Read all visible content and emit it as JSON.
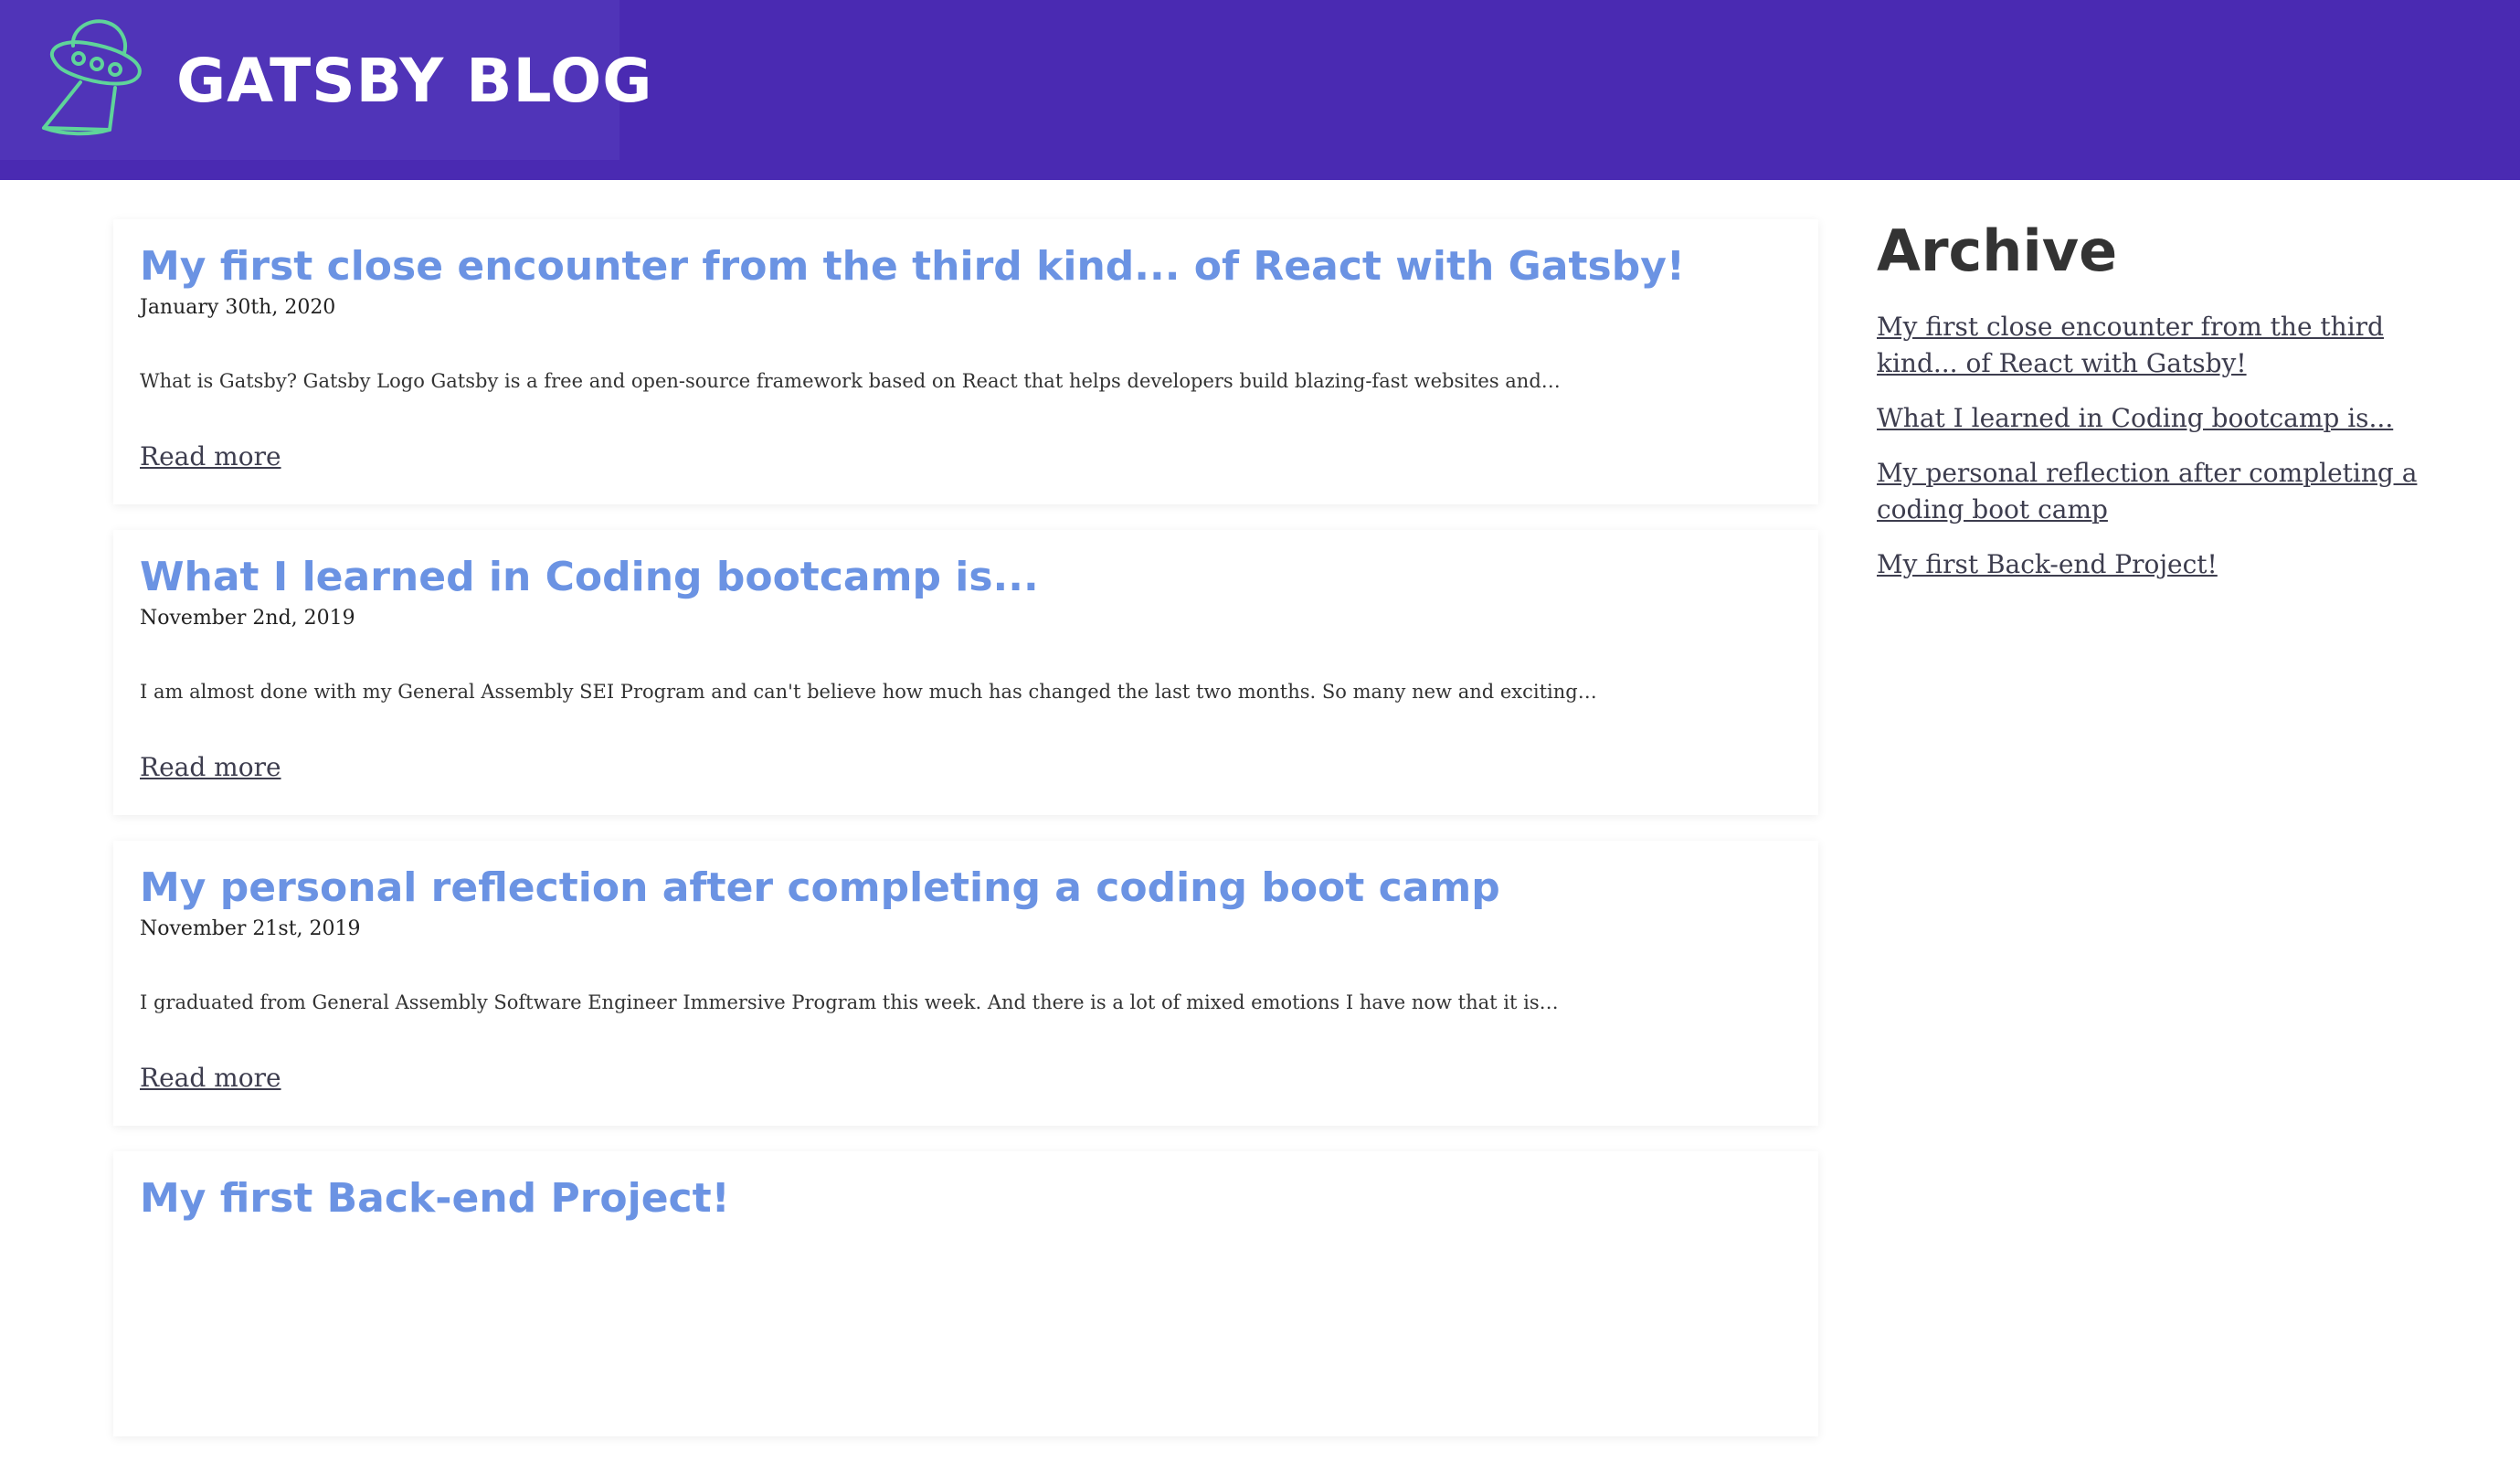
{
  "header": {
    "site_title": "GATSBY BLOG",
    "logo_icon": "ufo-icon",
    "background_color": "#4a2ab2",
    "logo_box_color": "#5034b8",
    "logo_icon_color": "#5fd49a"
  },
  "posts": [
    {
      "title": "My first close encounter from the third kind... of React with Gatsby!",
      "date": "January 30th, 2020",
      "excerpt": "What is Gatsby? Gatsby Logo Gatsby is a free and open-source framework based on React that helps developers build blazing-fast websites and…",
      "read_more": "Read more"
    },
    {
      "title": "What I learned in Coding bootcamp is...",
      "date": "November 2nd, 2019",
      "excerpt": "I am almost done with my General Assembly SEI Program and can't believe how much has changed the last two months. So many new and exciting…",
      "read_more": "Read more"
    },
    {
      "title": "My personal reflection after completing a coding boot camp",
      "date": "November 21st, 2019",
      "excerpt": "I graduated from General Assembly Software Engineer Immersive Program this week. And there is a lot of mixed emotions I have now that it is…",
      "read_more": "Read more"
    },
    {
      "title": "My first Back-end Project!"
    }
  ],
  "sidebar": {
    "title": "Archive",
    "links": [
      "My first close encounter from the third kind... of React with Gatsby!",
      "What I learned in Coding bootcamp is...",
      "My personal reflection after completing a coding boot camp",
      "My first Back-end Project!"
    ]
  },
  "colors": {
    "post_title": "#6b93e3",
    "link": "#3d3d4e"
  }
}
